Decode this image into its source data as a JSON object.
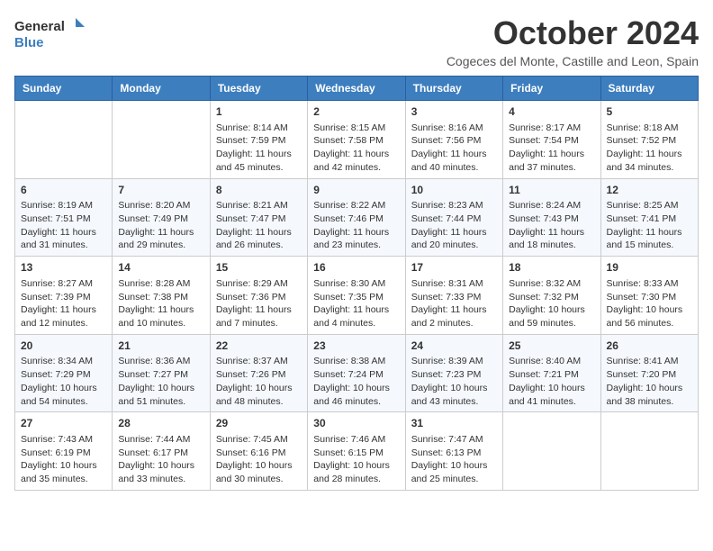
{
  "header": {
    "logo_line1": "General",
    "logo_line2": "Blue",
    "month_title": "October 2024",
    "subtitle": "Cogeces del Monte, Castille and Leon, Spain"
  },
  "days_of_week": [
    "Sunday",
    "Monday",
    "Tuesday",
    "Wednesday",
    "Thursday",
    "Friday",
    "Saturday"
  ],
  "weeks": [
    [
      {
        "day": "",
        "info": ""
      },
      {
        "day": "",
        "info": ""
      },
      {
        "day": "1",
        "info": "Sunrise: 8:14 AM\nSunset: 7:59 PM\nDaylight: 11 hours and 45 minutes."
      },
      {
        "day": "2",
        "info": "Sunrise: 8:15 AM\nSunset: 7:58 PM\nDaylight: 11 hours and 42 minutes."
      },
      {
        "day": "3",
        "info": "Sunrise: 8:16 AM\nSunset: 7:56 PM\nDaylight: 11 hours and 40 minutes."
      },
      {
        "day": "4",
        "info": "Sunrise: 8:17 AM\nSunset: 7:54 PM\nDaylight: 11 hours and 37 minutes."
      },
      {
        "day": "5",
        "info": "Sunrise: 8:18 AM\nSunset: 7:52 PM\nDaylight: 11 hours and 34 minutes."
      }
    ],
    [
      {
        "day": "6",
        "info": "Sunrise: 8:19 AM\nSunset: 7:51 PM\nDaylight: 11 hours and 31 minutes."
      },
      {
        "day": "7",
        "info": "Sunrise: 8:20 AM\nSunset: 7:49 PM\nDaylight: 11 hours and 29 minutes."
      },
      {
        "day": "8",
        "info": "Sunrise: 8:21 AM\nSunset: 7:47 PM\nDaylight: 11 hours and 26 minutes."
      },
      {
        "day": "9",
        "info": "Sunrise: 8:22 AM\nSunset: 7:46 PM\nDaylight: 11 hours and 23 minutes."
      },
      {
        "day": "10",
        "info": "Sunrise: 8:23 AM\nSunset: 7:44 PM\nDaylight: 11 hours and 20 minutes."
      },
      {
        "day": "11",
        "info": "Sunrise: 8:24 AM\nSunset: 7:43 PM\nDaylight: 11 hours and 18 minutes."
      },
      {
        "day": "12",
        "info": "Sunrise: 8:25 AM\nSunset: 7:41 PM\nDaylight: 11 hours and 15 minutes."
      }
    ],
    [
      {
        "day": "13",
        "info": "Sunrise: 8:27 AM\nSunset: 7:39 PM\nDaylight: 11 hours and 12 minutes."
      },
      {
        "day": "14",
        "info": "Sunrise: 8:28 AM\nSunset: 7:38 PM\nDaylight: 11 hours and 10 minutes."
      },
      {
        "day": "15",
        "info": "Sunrise: 8:29 AM\nSunset: 7:36 PM\nDaylight: 11 hours and 7 minutes."
      },
      {
        "day": "16",
        "info": "Sunrise: 8:30 AM\nSunset: 7:35 PM\nDaylight: 11 hours and 4 minutes."
      },
      {
        "day": "17",
        "info": "Sunrise: 8:31 AM\nSunset: 7:33 PM\nDaylight: 11 hours and 2 minutes."
      },
      {
        "day": "18",
        "info": "Sunrise: 8:32 AM\nSunset: 7:32 PM\nDaylight: 10 hours and 59 minutes."
      },
      {
        "day": "19",
        "info": "Sunrise: 8:33 AM\nSunset: 7:30 PM\nDaylight: 10 hours and 56 minutes."
      }
    ],
    [
      {
        "day": "20",
        "info": "Sunrise: 8:34 AM\nSunset: 7:29 PM\nDaylight: 10 hours and 54 minutes."
      },
      {
        "day": "21",
        "info": "Sunrise: 8:36 AM\nSunset: 7:27 PM\nDaylight: 10 hours and 51 minutes."
      },
      {
        "day": "22",
        "info": "Sunrise: 8:37 AM\nSunset: 7:26 PM\nDaylight: 10 hours and 48 minutes."
      },
      {
        "day": "23",
        "info": "Sunrise: 8:38 AM\nSunset: 7:24 PM\nDaylight: 10 hours and 46 minutes."
      },
      {
        "day": "24",
        "info": "Sunrise: 8:39 AM\nSunset: 7:23 PM\nDaylight: 10 hours and 43 minutes."
      },
      {
        "day": "25",
        "info": "Sunrise: 8:40 AM\nSunset: 7:21 PM\nDaylight: 10 hours and 41 minutes."
      },
      {
        "day": "26",
        "info": "Sunrise: 8:41 AM\nSunset: 7:20 PM\nDaylight: 10 hours and 38 minutes."
      }
    ],
    [
      {
        "day": "27",
        "info": "Sunrise: 7:43 AM\nSunset: 6:19 PM\nDaylight: 10 hours and 35 minutes."
      },
      {
        "day": "28",
        "info": "Sunrise: 7:44 AM\nSunset: 6:17 PM\nDaylight: 10 hours and 33 minutes."
      },
      {
        "day": "29",
        "info": "Sunrise: 7:45 AM\nSunset: 6:16 PM\nDaylight: 10 hours and 30 minutes."
      },
      {
        "day": "30",
        "info": "Sunrise: 7:46 AM\nSunset: 6:15 PM\nDaylight: 10 hours and 28 minutes."
      },
      {
        "day": "31",
        "info": "Sunrise: 7:47 AM\nSunset: 6:13 PM\nDaylight: 10 hours and 25 minutes."
      },
      {
        "day": "",
        "info": ""
      },
      {
        "day": "",
        "info": ""
      }
    ]
  ]
}
